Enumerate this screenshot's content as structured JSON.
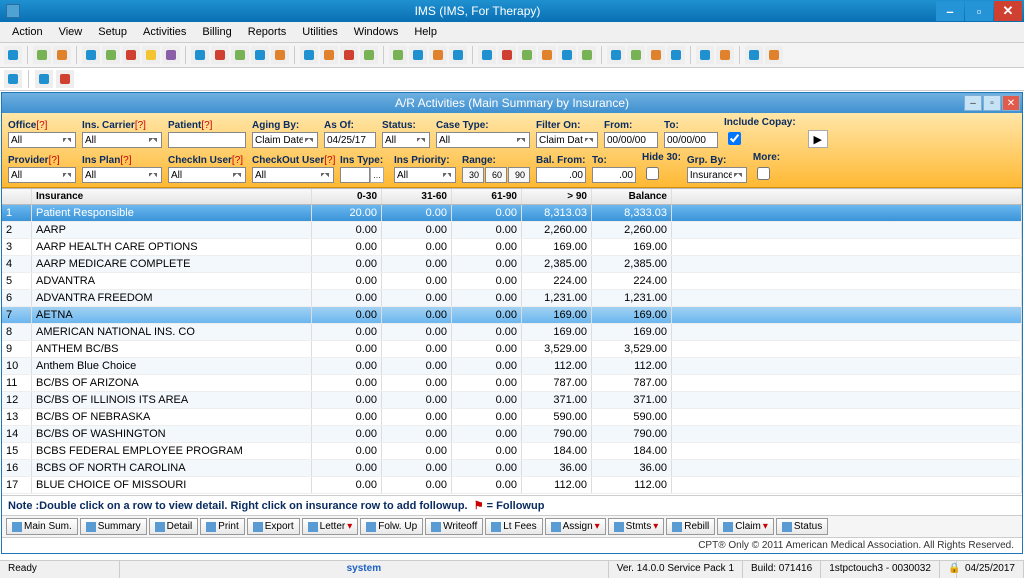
{
  "app_title": "IMS (IMS, For Therapy)",
  "menu": [
    "Action",
    "View",
    "Setup",
    "Activities",
    "Billing",
    "Reports",
    "Utilities",
    "Windows",
    "Help"
  ],
  "sub_title": "A/R Activities  (Main Summary by Insurance)",
  "filters": {
    "office": {
      "label": "Office",
      "value": "All"
    },
    "ins_carrier": {
      "label": "Ins. Carrier",
      "value": "All"
    },
    "patient": {
      "label": "Patient",
      "value": ""
    },
    "aging_by": {
      "label": "Aging By:",
      "value": "Claim Date"
    },
    "as_of": {
      "label": "As Of:",
      "value": "04/25/17"
    },
    "status": {
      "label": "Status:",
      "value": "All"
    },
    "case_type": {
      "label": "Case Type:",
      "value": "All"
    },
    "filter_on": {
      "label": "Filter On:",
      "value": "Claim Date"
    },
    "from": {
      "label": "From:",
      "value": "00/00/00"
    },
    "to": {
      "label": "To:",
      "value": "00/00/00"
    },
    "include_copay": {
      "label": "Include Copay:",
      "checked": true
    },
    "provider": {
      "label": "Provider",
      "value": "All"
    },
    "ins_plan": {
      "label": "Ins Plan",
      "value": "All"
    },
    "checkin_user": {
      "label": "CheckIn User",
      "value": "All"
    },
    "checkout_user": {
      "label": "CheckOut User",
      "value": "All"
    },
    "ins_type": {
      "label": "Ins Type:",
      "value": ""
    },
    "ins_priority": {
      "label": "Ins Priority:",
      "value": "All"
    },
    "range": {
      "label": "Range:",
      "b1": "30",
      "b2": "60",
      "b3": "90"
    },
    "bal_from": {
      "label": "Bal. From:",
      "value": ".00"
    },
    "bal_to": {
      "label": "To:",
      "value": ".00"
    },
    "hide_30": {
      "label": "Hide 30:",
      "checked": false
    },
    "grp_by": {
      "label": "Grp. By:",
      "value": "Insurance"
    },
    "more": {
      "label": "More:",
      "checked": false
    }
  },
  "columns": [
    "",
    "Insurance",
    "0-30",
    "31-60",
    "61-90",
    "> 90",
    "Balance"
  ],
  "rows": [
    {
      "n": "1",
      "ins": "Patient Responsible",
      "c1": "20.00",
      "c2": "0.00",
      "c3": "0.00",
      "c4": "8,313.03",
      "bal": "8,333.03",
      "sel": "hl"
    },
    {
      "n": "2",
      "ins": "AARP",
      "c1": "0.00",
      "c2": "0.00",
      "c3": "0.00",
      "c4": "2,260.00",
      "bal": "2,260.00"
    },
    {
      "n": "3",
      "ins": "AARP HEALTH CARE OPTIONS",
      "c1": "0.00",
      "c2": "0.00",
      "c3": "0.00",
      "c4": "169.00",
      "bal": "169.00"
    },
    {
      "n": "4",
      "ins": "AARP MEDICARE COMPLETE",
      "c1": "0.00",
      "c2": "0.00",
      "c3": "0.00",
      "c4": "2,385.00",
      "bal": "2,385.00"
    },
    {
      "n": "5",
      "ins": "ADVANTRA",
      "c1": "0.00",
      "c2": "0.00",
      "c3": "0.00",
      "c4": "224.00",
      "bal": "224.00"
    },
    {
      "n": "6",
      "ins": "ADVANTRA FREEDOM",
      "c1": "0.00",
      "c2": "0.00",
      "c3": "0.00",
      "c4": "1,231.00",
      "bal": "1,231.00"
    },
    {
      "n": "7",
      "ins": "AETNA",
      "c1": "0.00",
      "c2": "0.00",
      "c3": "0.00",
      "c4": "169.00",
      "bal": "169.00",
      "sel": "bl"
    },
    {
      "n": "8",
      "ins": "AMERICAN NATIONAL INS. CO",
      "c1": "0.00",
      "c2": "0.00",
      "c3": "0.00",
      "c4": "169.00",
      "bal": "169.00"
    },
    {
      "n": "9",
      "ins": "ANTHEM BC/BS",
      "c1": "0.00",
      "c2": "0.00",
      "c3": "0.00",
      "c4": "3,529.00",
      "bal": "3,529.00"
    },
    {
      "n": "10",
      "ins": "Anthem Blue Choice",
      "c1": "0.00",
      "c2": "0.00",
      "c3": "0.00",
      "c4": "112.00",
      "bal": "112.00"
    },
    {
      "n": "11",
      "ins": "BC/BS OF ARIZONA",
      "c1": "0.00",
      "c2": "0.00",
      "c3": "0.00",
      "c4": "787.00",
      "bal": "787.00"
    },
    {
      "n": "12",
      "ins": "BC/BS OF ILLINOIS ITS AREA",
      "c1": "0.00",
      "c2": "0.00",
      "c3": "0.00",
      "c4": "371.00",
      "bal": "371.00"
    },
    {
      "n": "13",
      "ins": "BC/BS OF NEBRASKA",
      "c1": "0.00",
      "c2": "0.00",
      "c3": "0.00",
      "c4": "590.00",
      "bal": "590.00"
    },
    {
      "n": "14",
      "ins": "BC/BS OF WASHINGTON",
      "c1": "0.00",
      "c2": "0.00",
      "c3": "0.00",
      "c4": "790.00",
      "bal": "790.00"
    },
    {
      "n": "15",
      "ins": "BCBS FEDERAL EMPLOYEE PROGRAM",
      "c1": "0.00",
      "c2": "0.00",
      "c3": "0.00",
      "c4": "184.00",
      "bal": "184.00"
    },
    {
      "n": "16",
      "ins": "BCBS OF NORTH CAROLINA",
      "c1": "0.00",
      "c2": "0.00",
      "c3": "0.00",
      "c4": "36.00",
      "bal": "36.00"
    },
    {
      "n": "17",
      "ins": "BLUE CHOICE OF MISSOURI",
      "c1": "0.00",
      "c2": "0.00",
      "c3": "0.00",
      "c4": "112.00",
      "bal": "112.00"
    }
  ],
  "note": "Note :Double click on a row to view detail.  Right click on insurance row to add followup.",
  "note_flag": "= Followup",
  "bottom_buttons": [
    "Main Sum.",
    "Summary",
    "Detail",
    "Print",
    "Export",
    "Letter",
    "Folw. Up",
    "Writeoff",
    "Lt Fees",
    "Assign",
    "Stmts",
    "Rebill",
    "Claim",
    "Status"
  ],
  "copyright": "CPT® Only © 2011 American Medical Association. All Rights Reserved.",
  "status": {
    "ready": "Ready",
    "system": "system",
    "ver": "Ver. 14.0.0 Service Pack 1",
    "build": "Build: 071416",
    "user": "1stpctouch3 - 0030032",
    "date": "04/25/2017"
  }
}
